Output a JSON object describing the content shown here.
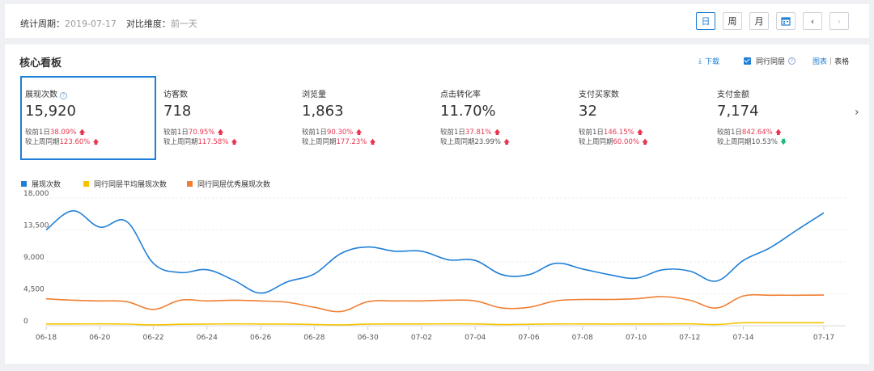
{
  "header": {
    "period_label": "统计周期：",
    "period_value": "2019-07-17",
    "compare_label": "对比维度：",
    "compare_value": "前一天",
    "buttons": {
      "day": "日",
      "week": "周",
      "month": "月"
    }
  },
  "panel": {
    "title": "核心看板",
    "download": "下载",
    "peer_checkbox": "同行同层",
    "help_mark": "?",
    "view_chart": "图表",
    "separator": "|",
    "view_table": "表格"
  },
  "metrics": [
    {
      "label": "展现次数",
      "has_help": true,
      "value": "15,920",
      "line1_prefix": "较前1日",
      "line1_pct": "38.09%",
      "line1_dir": "up",
      "line2_prefix": "较上周同期",
      "line2_pct": "123.60%",
      "line2_dir": "up"
    },
    {
      "label": "访客数",
      "value": "718",
      "line1_prefix": "较前1日",
      "line1_pct": "70.95%",
      "line1_dir": "up",
      "line2_prefix": "较上周同期",
      "line2_pct": "117.58%",
      "line2_dir": "up"
    },
    {
      "label": "浏览量",
      "value": "1,863",
      "line1_prefix": "较前1日",
      "line1_pct": "90.30%",
      "line1_dir": "up",
      "line2_prefix": "较上周同期",
      "line2_pct": "177.23%",
      "line2_dir": "up"
    },
    {
      "label": "点击转化率",
      "value": "11.70%",
      "line1_prefix": "较前1日",
      "line1_pct": "37.81%",
      "line1_dir": "up",
      "line2_prefix": "较上周同期",
      "line2_pct": "23.99%",
      "line2_dir": "up"
    },
    {
      "label": "支付买家数",
      "value": "32",
      "line1_prefix": "较前1日",
      "line1_pct": "146.15%",
      "line1_dir": "up",
      "line2_prefix": "较上周同期",
      "line2_pct": "60.00%",
      "line2_dir": "up"
    },
    {
      "label": "支付金额",
      "value": "7,174",
      "line1_prefix": "较前1日",
      "line1_pct": "842.64%",
      "line1_dir": "up",
      "line2_prefix": "较上周同期",
      "line2_pct": "10.53%",
      "line2_dir": "down"
    }
  ],
  "colors": {
    "accent": "#1f7fd6",
    "up": "#e8344e",
    "down": "#20b978"
  },
  "chart_data": {
    "type": "line",
    "x": [
      "06-18",
      "06-19",
      "06-20",
      "06-21",
      "06-22",
      "06-23",
      "06-24",
      "06-25",
      "06-26",
      "06-27",
      "06-28",
      "06-29",
      "06-30",
      "07-01",
      "07-02",
      "07-03",
      "07-04",
      "07-05",
      "07-06",
      "07-07",
      "07-08",
      "07-09",
      "07-10",
      "07-11",
      "07-12",
      "07-13",
      "07-14",
      "07-15",
      "07-16",
      "07-17"
    ],
    "x_tick_labels": [
      "06-18",
      "06-20",
      "06-22",
      "06-24",
      "06-26",
      "06-28",
      "06-30",
      "07-02",
      "07-04",
      "07-06",
      "07-08",
      "07-10",
      "07-12",
      "07-14",
      "07-17"
    ],
    "ylim": [
      0,
      18000
    ],
    "y_ticks": [
      0,
      4500,
      9000,
      13500,
      18000
    ],
    "y_tick_labels": [
      "0",
      "4,500",
      "9,000",
      "13,500",
      "18,000"
    ],
    "grid": "horizontal",
    "legend_position": "top-left",
    "series": [
      {
        "name": "展现次数",
        "color": "#1f7fd6",
        "values": [
          13500,
          16200,
          13900,
          14700,
          8800,
          7500,
          7900,
          6400,
          4600,
          6200,
          7300,
          10200,
          11100,
          10500,
          10500,
          9300,
          9200,
          7200,
          7200,
          8800,
          8000,
          7200,
          6700,
          7900,
          7700,
          6300,
          9200,
          11000,
          13500,
          15920
        ]
      },
      {
        "name": "同行同层平均展现次数",
        "color": "#f5c400",
        "values": [
          250,
          250,
          260,
          230,
          120,
          200,
          240,
          260,
          240,
          230,
          180,
          120,
          240,
          250,
          250,
          260,
          250,
          170,
          210,
          250,
          250,
          240,
          250,
          250,
          260,
          170,
          420,
          420,
          420,
          420
        ]
      },
      {
        "name": "同行同层优秀展现次数",
        "color": "#f07f32",
        "values": [
          3800,
          3600,
          3500,
          3400,
          2300,
          3600,
          3500,
          3600,
          3500,
          3300,
          2600,
          2000,
          3400,
          3500,
          3500,
          3600,
          3500,
          2500,
          2600,
          3500,
          3700,
          3700,
          3800,
          4100,
          3600,
          2500,
          4200,
          4300,
          4300,
          4320
        ]
      }
    ]
  }
}
